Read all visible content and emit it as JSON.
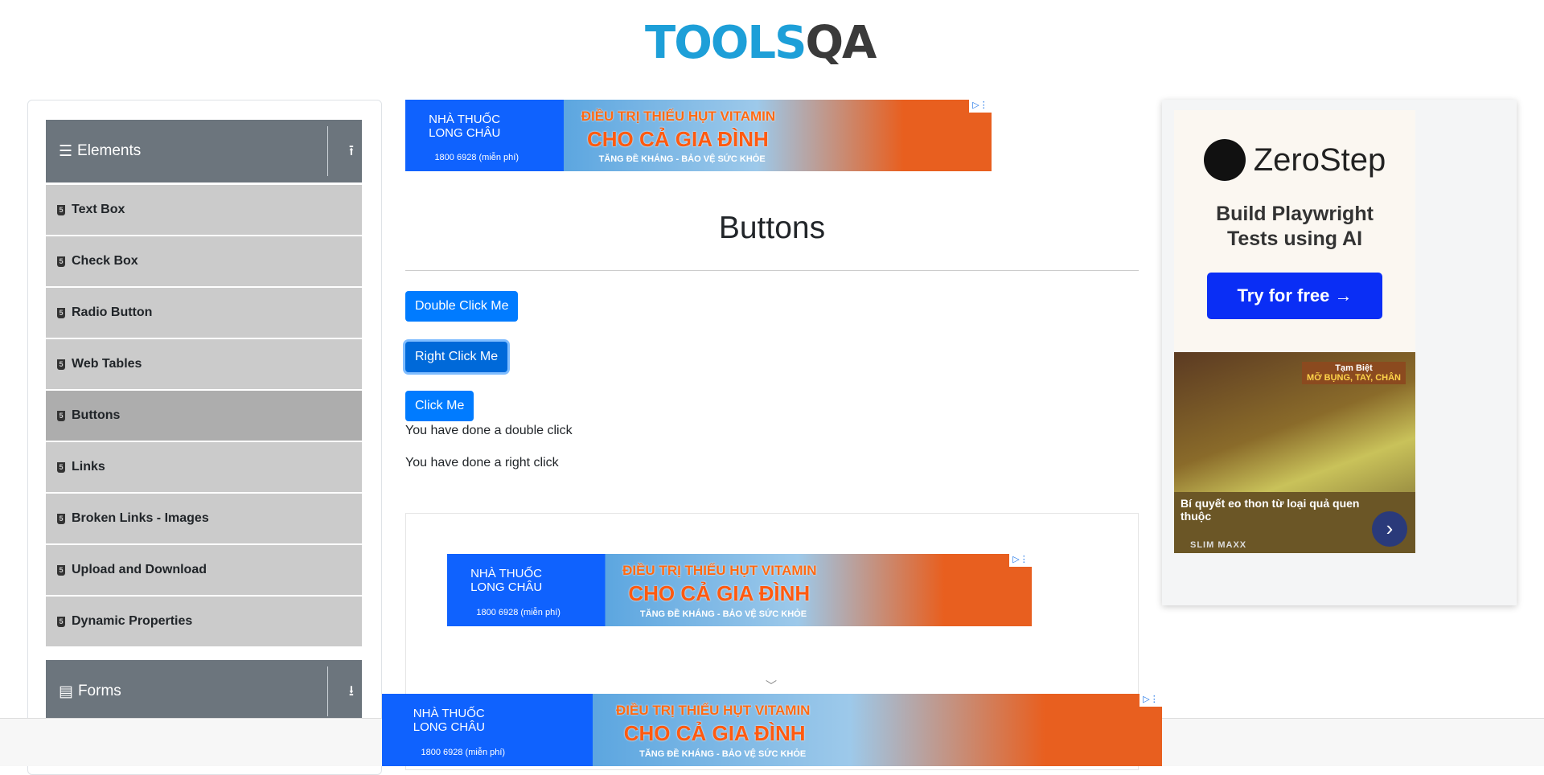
{
  "logo": {
    "part1": "TOOLS",
    "part2": "QA"
  },
  "sidebar": {
    "groups": [
      {
        "label": "Elements",
        "icon": "hamburger-icon"
      },
      {
        "label": "Forms",
        "icon": "document-icon"
      }
    ],
    "items": [
      "Text Box",
      "Check Box",
      "Radio Button",
      "Web Tables",
      "Buttons",
      "Links",
      "Broken Links - Images",
      "Upload and Download",
      "Dynamic Properties"
    ],
    "active": "Buttons"
  },
  "ad_banner": {
    "brand1": "NHÀ THUỐC",
    "brand2": "LONG CHÂU",
    "phone": "1800 6928 (miễn phí)",
    "line1": "ĐIỀU TRỊ THIẾU HỤT VITAMIN",
    "line2": "CHO CẢ GIA ĐÌNH",
    "line3": "TĂNG ĐỀ KHÁNG - BẢO VỆ SỨC KHỎE"
  },
  "main": {
    "title": "Buttons",
    "buttons": {
      "double": "Double Click Me",
      "right": "Right Click Me",
      "click": "Click Me"
    },
    "messages": {
      "double": "You have done a double click",
      "right": "You have done a right click"
    }
  },
  "right_ad": {
    "brand": "ZeroStep",
    "subtitle1": "Build Playwright",
    "subtitle2": "Tests using AI",
    "cta": "Try for free →",
    "tag1": "Tạm Biệt",
    "tag2": "MỠ BỤNG, TAY, CHÂN",
    "caption": "Bí quyết eo thon từ loại quả quen thuộc",
    "source": "SLIM MAXX"
  },
  "colors": {
    "primary": "#007bff",
    "sidebar_header": "#6c757d",
    "sidebar_item": "#cbcbcb"
  }
}
